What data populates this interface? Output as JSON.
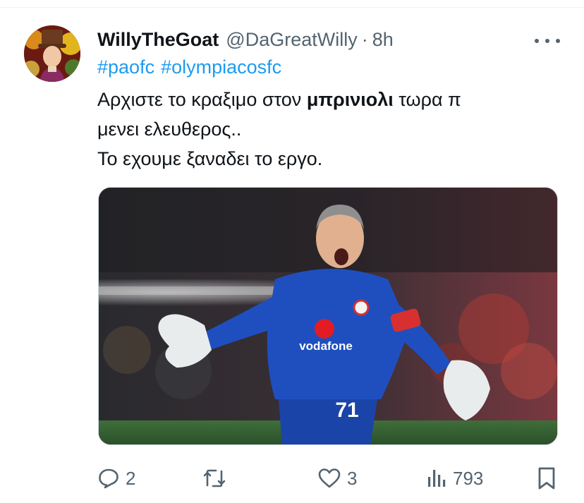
{
  "tweet": {
    "display_name": "WillyTheGoat",
    "handle": "@DaGreatWilly",
    "separator": "·",
    "time": "8h",
    "hashtags": [
      "#paofc",
      "#olympiacosfc"
    ],
    "text": {
      "line1_before": "Αρχιστε το κραξιμο στον ",
      "line1_bold": "μπρινιολι",
      "line1_after": " τωρα π",
      "line2": "μενει ελευθερος..",
      "line3": "Το εχουμε ξαναδει το εργο."
    },
    "media": {
      "jersey_sponsor": "vodafone",
      "jersey_number": "71"
    }
  },
  "actions": {
    "replies": "2",
    "reposts": "",
    "likes": "3",
    "views": "793"
  },
  "icons": {
    "avatar": "avatar-portrait",
    "more": "more-icon",
    "reply": "reply-icon",
    "repost": "repost-icon",
    "like": "heart-icon",
    "views": "views-icon",
    "bookmark": "bookmark-icon"
  },
  "colors": {
    "link": "#1d9bf0",
    "secondary_text": "#536471",
    "primary_text": "#0f1419",
    "jersey_blue": "#1f4fbf"
  }
}
